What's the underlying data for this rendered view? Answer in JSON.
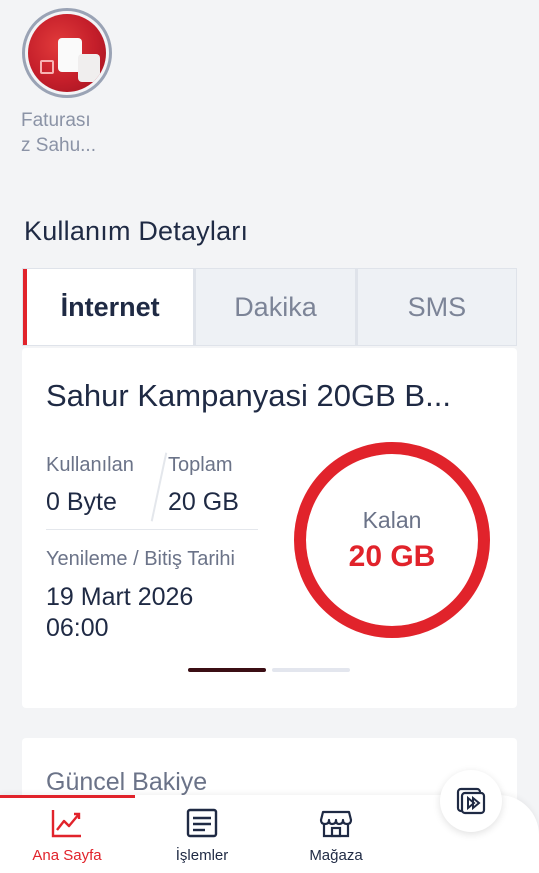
{
  "story": {
    "label_line1": "Faturası",
    "label_line2": "z Sahu..."
  },
  "usage": {
    "section_title": "Kullanım Detayları",
    "tabs": [
      {
        "label": "İnternet",
        "active": true
      },
      {
        "label": "Dakika",
        "active": false
      },
      {
        "label": "SMS",
        "active": false
      }
    ],
    "package": {
      "title": "Sahur Kampanyasi 20GB B...",
      "used_label": "Kullanılan",
      "used_value": "0 Byte",
      "total_label": "Toplam",
      "total_value": "20 GB",
      "renew_label": "Yenileme / Bitiş Tarihi",
      "renew_date": "19 Mart 2026",
      "renew_time": "06:00",
      "remaining_label": "Kalan",
      "remaining_value": "20 GB",
      "remaining_fraction": 1.0
    },
    "pager": {
      "pages": 2,
      "active_index": 0
    }
  },
  "balance": {
    "title": "Güncel Bakiye"
  },
  "bottom_nav": {
    "items": [
      {
        "label": "Ana Sayfa",
        "icon": "chart-line-icon",
        "active": true
      },
      {
        "label": "İşlemler",
        "icon": "receipt-icon",
        "active": false
      },
      {
        "label": "Mağaza",
        "icon": "store-icon",
        "active": false
      }
    ],
    "fab_icon": "media-play-icon"
  },
  "colors": {
    "accent": "#e1232b",
    "text_primary": "#1f2a44",
    "text_secondary": "#6b7388",
    "background": "#f3f4f6"
  }
}
